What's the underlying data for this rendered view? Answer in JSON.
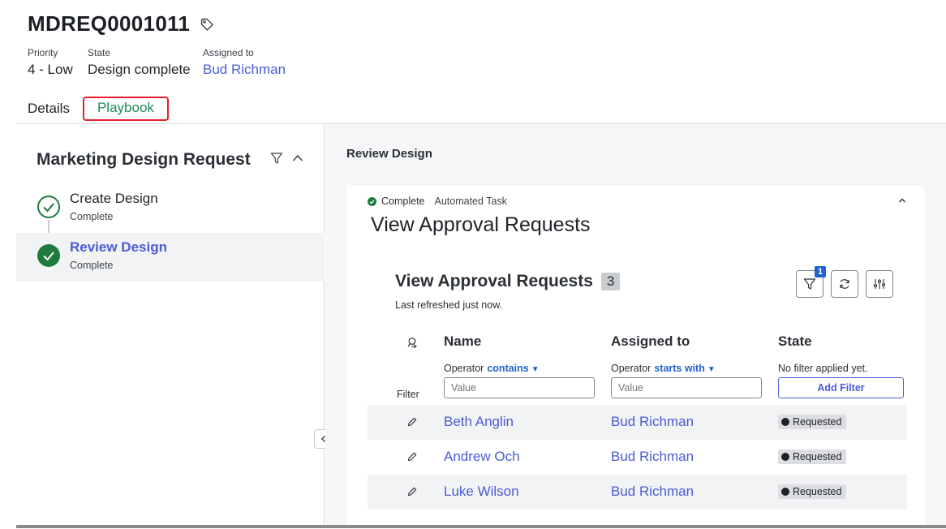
{
  "record": {
    "number": "MDREQ0001011",
    "fields": [
      {
        "label": "Priority",
        "value": "4 - Low"
      },
      {
        "label": "State",
        "value": "Design complete"
      },
      {
        "label": "Assigned to",
        "value": "Bud Richman"
      }
    ]
  },
  "tabs": [
    {
      "label": "Details"
    },
    {
      "label": "Playbook",
      "selected": true
    }
  ],
  "playbook": {
    "title": "Marketing Design Request",
    "steps": [
      {
        "name": "Create Design",
        "status": "Complete"
      },
      {
        "name": "Review Design",
        "status": "Complete",
        "active": true
      }
    ]
  },
  "main": {
    "section_title": "Review Design",
    "card": {
      "status": "Complete",
      "type": "Automated Task",
      "title": "View Approval Requests"
    },
    "list": {
      "title": "View Approval Requests",
      "count": "3",
      "refreshed": "Last refreshed just now.",
      "filter_badge": "1",
      "columns": [
        "Name",
        "Assigned to",
        "State"
      ],
      "filter_label": "Filter",
      "filters": {
        "name": {
          "operator_label": "Operator",
          "operator": "contains",
          "placeholder": "Value"
        },
        "assigned": {
          "operator_label": "Operator",
          "operator": "starts with",
          "placeholder": "Value"
        },
        "state": {
          "text": "No filter applied yet.",
          "button": "Add Filter"
        }
      },
      "rows": [
        {
          "name": "Beth Anglin",
          "assigned_to": "Bud Richman",
          "state": "Requested"
        },
        {
          "name": "Andrew Och",
          "assigned_to": "Bud Richman",
          "state": "Requested"
        },
        {
          "name": "Luke Wilson",
          "assigned_to": "Bud Richman",
          "state": "Requested"
        }
      ]
    }
  },
  "icons": {
    "tag": "tag-icon",
    "filter": "filter-icon",
    "collapse": "chevron-up-icon",
    "step_done": "check-circle-icon",
    "refresh": "refresh-icon",
    "settings": "sliders-icon",
    "edit": "pencil-icon",
    "search_columns": "column-search-icon",
    "panel_toggle": "chevron-left-icon"
  },
  "colors": {
    "link": "#4a5bd4",
    "selected_tab": "#1a8c5c",
    "highlight_border": "#e5202b",
    "complete": "#1f7a3d",
    "badge": "#1f63d1"
  }
}
